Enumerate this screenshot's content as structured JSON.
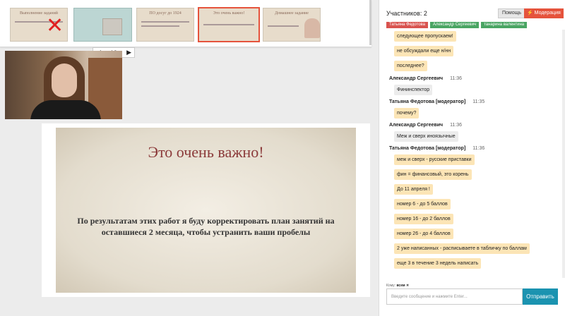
{
  "thumbnails": {
    "t1_title": "Выполнение заданий",
    "t3_title": "ПО досуг до 1924",
    "t4_title": "Это очень важно!",
    "t5_title": "Домашнее задание"
  },
  "pager": {
    "prev": "◀",
    "page": "19",
    "next": "▶"
  },
  "slide": {
    "title": "Это очень важно!",
    "body": "По результатам этих работ я буду корректировать план занятий на оставшиеся 2 месяца, чтобы устранить ваши пробелы"
  },
  "panel": {
    "participants": "Участников: 2",
    "help": "Помощь",
    "moderation": "Модерация",
    "users": [
      "Татьяна Федотова",
      "Александр Сергеевич",
      "танарина валентина"
    ]
  },
  "messages": [
    {
      "type": "bubble",
      "style": "y",
      "text": "следующее пропускаем!"
    },
    {
      "type": "bubble",
      "style": "y",
      "text": "не обсуждали еще н/нн"
    },
    {
      "type": "bubble",
      "style": "y",
      "text": "последнее?"
    },
    {
      "type": "head",
      "author": "Александр Сергеевич",
      "time": "11:36"
    },
    {
      "type": "bubble",
      "style": "g",
      "text": "Фининспектор"
    },
    {
      "type": "head",
      "author": "Татьяна Федотова [модератор]",
      "time": "11:35"
    },
    {
      "type": "bubble",
      "style": "y",
      "text": "почему?"
    },
    {
      "type": "head",
      "author": "Александр Сергеевич",
      "time": "11:36"
    },
    {
      "type": "bubble",
      "style": "g",
      "text": "Меж и сверх иноязычные"
    },
    {
      "type": "head",
      "author": "Татьяна Федотова [модератор]",
      "time": "11:36"
    },
    {
      "type": "bubble",
      "style": "y",
      "text": "меж и сверх - русские приставки"
    },
    {
      "type": "bubble",
      "style": "y",
      "text": "фин = финансовый, это корень"
    },
    {
      "type": "bubble",
      "style": "y",
      "text": "До 11 апреля !"
    },
    {
      "type": "bubble",
      "style": "y",
      "text": "номер 6 - до 5 баллов"
    },
    {
      "type": "bubble",
      "style": "y",
      "text": "номер 16 - до 2 баллов"
    },
    {
      "type": "bubble",
      "style": "y",
      "text": "номер 26 - до 4 баллов"
    },
    {
      "type": "bubble",
      "style": "y",
      "text": "2 уже написанных - расписываете в табличку по баллам"
    },
    {
      "type": "bubble",
      "style": "y",
      "text": "еще 3 в течение 3 недель написать"
    }
  ],
  "composer": {
    "to_label": "Кому:",
    "to_value": "всем",
    "placeholder": "Введите сообщение и нажмите Enter...",
    "send": "Отправить"
  },
  "colors": {
    "accent": "#e5533c",
    "send": "#1b93b0",
    "bubble_yellow": "#fce5b6"
  }
}
